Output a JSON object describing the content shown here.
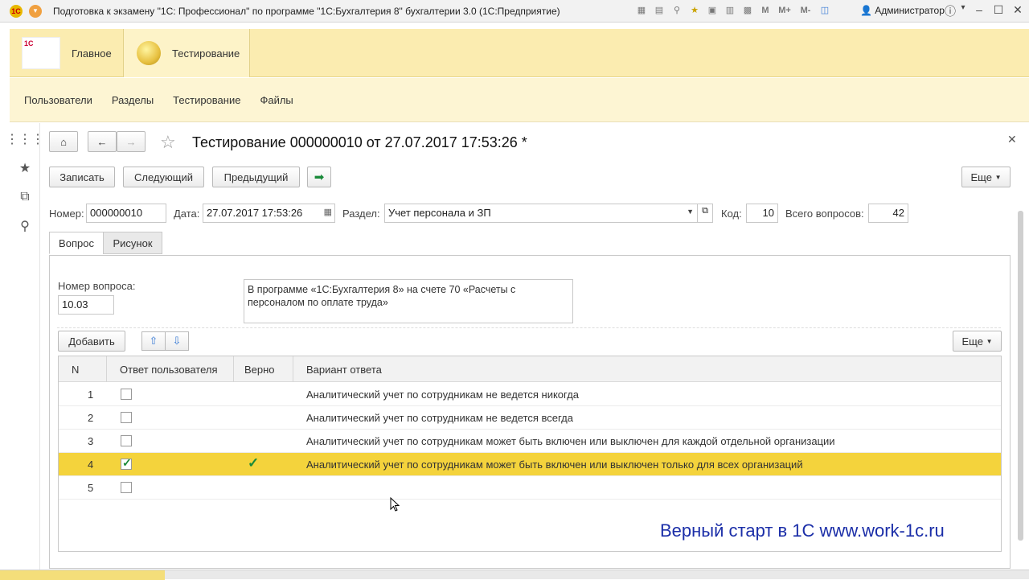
{
  "window": {
    "title": "Подготовка к экзамену \"1С: Профессионал\" по программе \"1С:Бухгалтерия 8\" бухгалтерии 3.0  (1С:Предприятие)",
    "user": "Администратор"
  },
  "sections": {
    "main": "Главное",
    "testing": "Тестирование",
    "logo_text": "1С"
  },
  "subnav": [
    "Пользователи",
    "Разделы",
    "Тестирование",
    "Файлы"
  ],
  "document": {
    "title": "Тестирование 000000010 от 27.07.2017 17:53:26 *",
    "buttons": {
      "save": "Записать",
      "next": "Следующий",
      "prev": "Предыдущий",
      "more": "Еще"
    },
    "fields": {
      "number_label": "Номер:",
      "number": "000000010",
      "date_label": "Дата:",
      "date": "27.07.2017 17:53:26",
      "section_label": "Раздел:",
      "section": "Учет персонала и ЗП",
      "code_label": "Код:",
      "code": "10",
      "total_label": "Всего вопросов:",
      "total": "42"
    },
    "tabs": [
      "Вопрос",
      "Рисунок"
    ],
    "question": {
      "number_label": "Номер вопроса:",
      "number": "10.03",
      "text": "В программе «1С:Бухгалтерия 8» на счете 70 «Расчеты с персоналом по оплате труда»"
    },
    "grid_toolbar": {
      "add": "Добавить",
      "more": "Еще"
    },
    "grid": {
      "columns": [
        "N",
        "Ответ пользователя",
        "Верно",
        "Вариант ответа"
      ],
      "rows": [
        {
          "n": "1",
          "user_answer": false,
          "correct": false,
          "text": "Аналитический учет по сотрудникам не ведется никогда"
        },
        {
          "n": "2",
          "user_answer": false,
          "correct": false,
          "text": "Аналитический учет по сотрудникам не ведется всегда"
        },
        {
          "n": "3",
          "user_answer": false,
          "correct": false,
          "text": "Аналитический учет по сотрудникам может быть включен или выключен для каждой отдельной организации"
        },
        {
          "n": "4",
          "user_answer": true,
          "correct": true,
          "text": "Аналитический учет по сотрудникам может быть включен или выключен только для всех организаций"
        },
        {
          "n": "5",
          "user_answer": false,
          "correct": false,
          "text": ""
        }
      ]
    }
  },
  "watermark": "Верный старт в 1С www.work-1c.ru",
  "colors": {
    "accent_yellow": "#f4d33c",
    "section_bg": "#fbecb0",
    "watermark": "#1b2ea8"
  }
}
